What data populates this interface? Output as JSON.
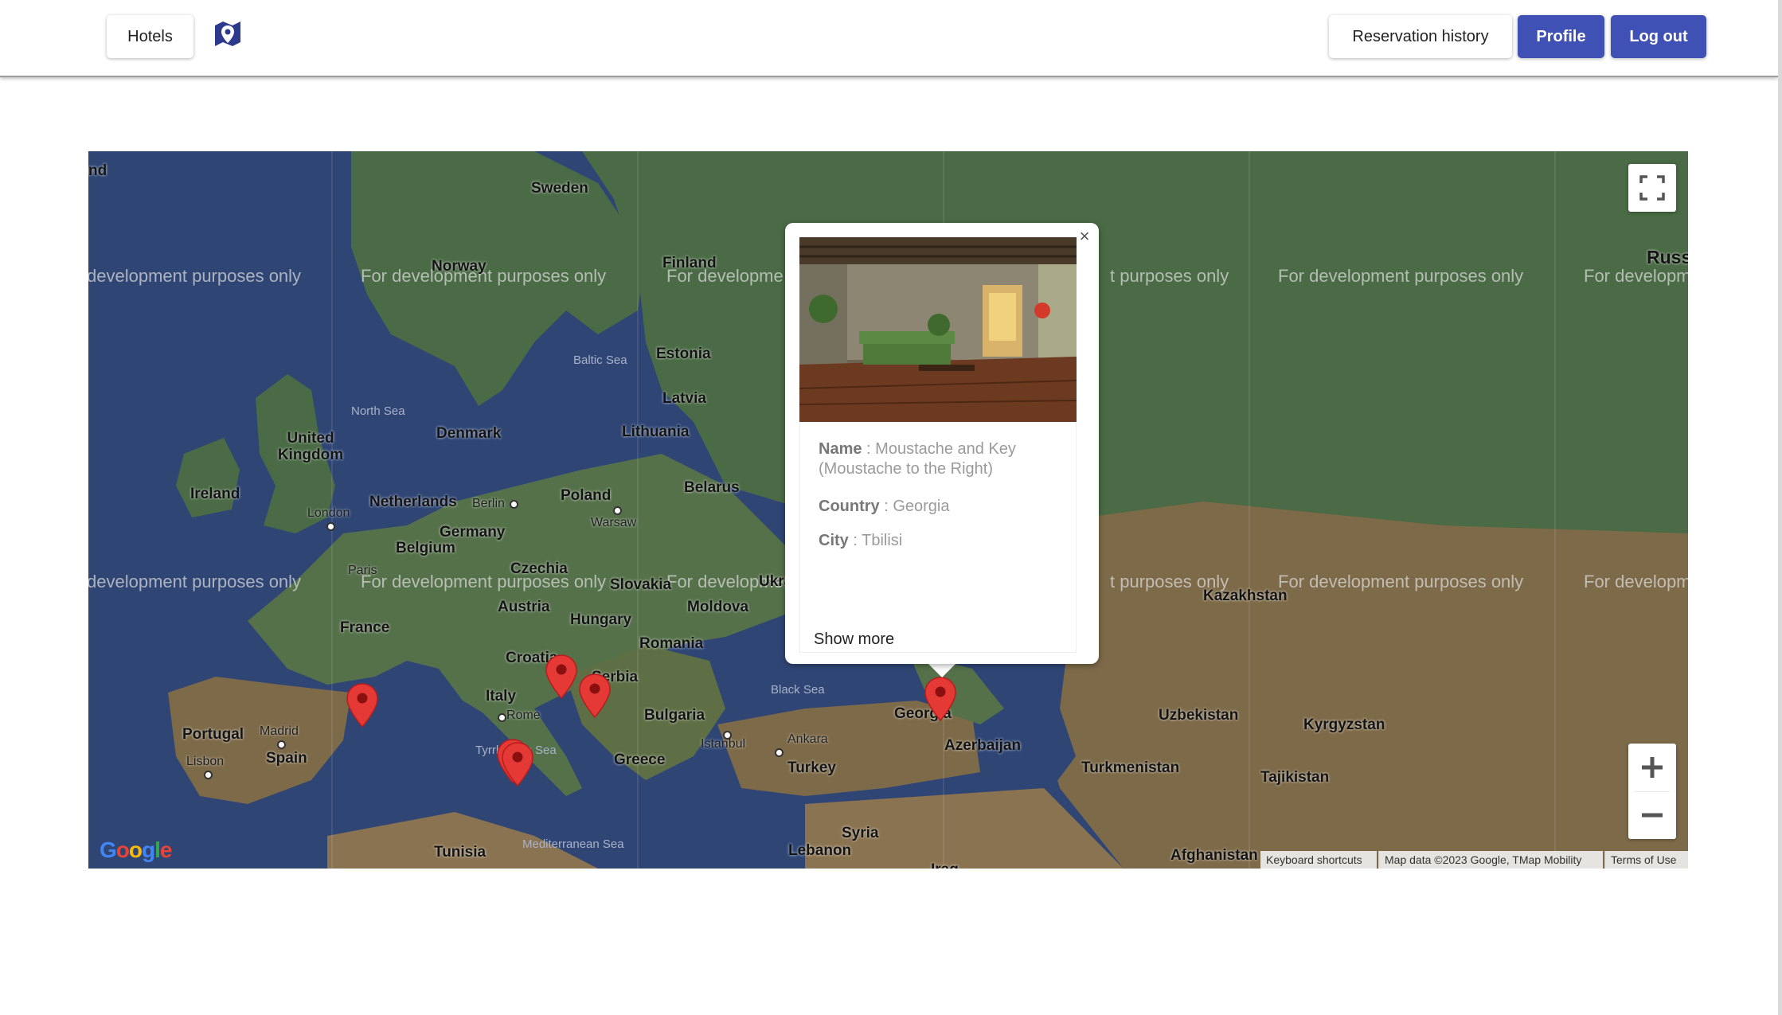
{
  "nav": {
    "hotels_label": "Hotels",
    "logo_icon": "map-marker-icon",
    "reservation_history_label": "Reservation history",
    "profile_label": "Profile",
    "logout_label": "Log out"
  },
  "colors": {
    "primary": "#3f51b5",
    "marker": "#e53935",
    "map_water": "#2f4675",
    "map_land_green": "#4a6b45",
    "map_land_brown": "#7d6a48"
  },
  "map": {
    "watermark": "For development purposes only",
    "watermark_fragment": "development purposes only",
    "watermark_fragment_right": "For developm",
    "watermark_fragment_mid": "For developme",
    "watermark_fragment_mid2": "t purposes only",
    "countries": [
      "Sweden",
      "Norway",
      "Finland",
      "Estonia",
      "Latvia",
      "Lithuania",
      "Denmark",
      "United Kingdom",
      "Ireland",
      "Netherlands",
      "Belgium",
      "Germany",
      "Poland",
      "Belarus",
      "Czechia",
      "Slovakia",
      "Austria",
      "Hungary",
      "Moldova",
      "Romania",
      "France",
      "Croatia",
      "Serbia",
      "Italy",
      "Bulgaria",
      "Portugal",
      "Spain",
      "Greece",
      "Turkey",
      "Georgia",
      "Azerbaijan",
      "Kazakhstan",
      "Uzbekistan",
      "Kyrgyzstan",
      "Turkmenistan",
      "Tajikistan",
      "Afghanistan",
      "Syria",
      "Lebanon",
      "Tunisia",
      "Russ",
      "Ukraine",
      "Iraq"
    ],
    "seas": [
      "Baltic Sea",
      "North Sea",
      "Black Sea",
      "Tyrrhenian Sea",
      "Mediterranean Sea"
    ],
    "cities": [
      "London",
      "Berlin",
      "Warsaw",
      "Paris",
      "Rome",
      "Madrid",
      "Lisbon",
      "Istanbul",
      "Ankara"
    ],
    "fullscreen_icon": "fullscreen-icon",
    "zoom_in_icon": "plus-icon",
    "zoom_out_icon": "minus-icon",
    "google_logo": "Google",
    "attribution": {
      "shortcuts": "Keyboard shortcuts",
      "data": "Map data ©2023 Google, TMap Mobility",
      "terms": "Terms of Use"
    }
  },
  "info_window": {
    "close_icon": "close-icon",
    "name_label": "Name",
    "name_value": "Moustache and Key (Moustache to the Right)",
    "country_label": "Country",
    "country_value": "Georgia",
    "city_label": "City",
    "city_value": "Tbilisi",
    "show_more_label": "Show more"
  }
}
